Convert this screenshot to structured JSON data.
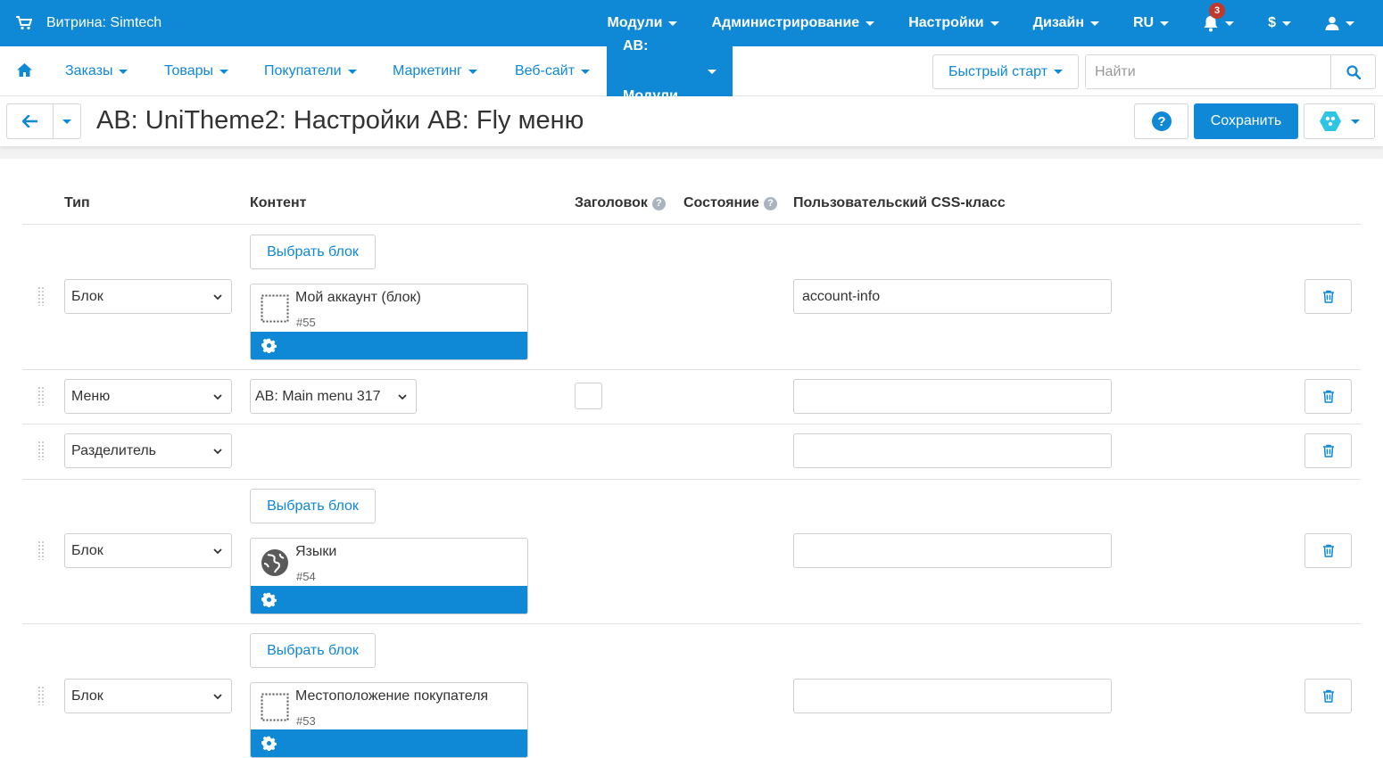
{
  "topbar": {
    "storefront": "Витрина: Simtech",
    "menu": [
      "Модули",
      "Администрирование",
      "Настройки",
      "Дизайн",
      "RU"
    ],
    "notifications_count": "3",
    "currency": "$"
  },
  "nav": {
    "items": [
      "Заказы",
      "Товары",
      "Покупатели",
      "Маркетинг",
      "Веб-сайт",
      "AB: Модули"
    ],
    "quick_start": "Быстрый старт",
    "search_placeholder": "Найти"
  },
  "title": {
    "text": "AB: UniTheme2: Настройки AB: Fly меню",
    "save": "Сохранить"
  },
  "table": {
    "headers": {
      "type": "Тип",
      "content": "Контент",
      "heading": "Заголовок",
      "state": "Состояние",
      "css": "Пользовательский CSS-класс"
    },
    "rows": [
      {
        "type": "Блок",
        "select_block": "Выбрать блок",
        "block_name": "Мой аккаунт (блок)",
        "block_id": "#55",
        "block_icon": "dotted-square-icon",
        "css": "account-info"
      },
      {
        "type": "Меню",
        "menu": "AB: Main menu 317",
        "css": ""
      },
      {
        "type": "Разделитель",
        "css": ""
      },
      {
        "type": "Блок",
        "select_block": "Выбрать блок",
        "block_name": "Языки",
        "block_id": "#54",
        "block_icon": "globe-icon",
        "css": ""
      },
      {
        "type": "Блок",
        "select_block": "Выбрать блок",
        "block_name": "Местоположение покупателя",
        "block_id": "#53",
        "block_icon": "dotted-square-icon",
        "css": ""
      }
    ]
  },
  "colors": {
    "accent": "#0f88d6",
    "badge": "#c0392b"
  }
}
